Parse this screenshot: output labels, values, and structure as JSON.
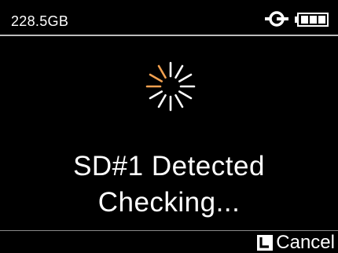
{
  "status_bar": {
    "storage_remaining": "228.5GB",
    "connector_icon": "power-connector-icon",
    "battery_icon": "battery-full-icon",
    "battery_level": 1.0
  },
  "dialog": {
    "spinner_icon": "loading-spinner-icon",
    "line1": "SD#1 Detected",
    "line2": "Checking..."
  },
  "footer": {
    "key_icon": "l-button-icon",
    "cancel_label": "Cancel"
  },
  "colors": {
    "background": "#000000",
    "text": "#ffffff",
    "spinner_highlight": "#f0a050",
    "spinner_base": "#ffffff",
    "divider": "#bcbcbc"
  }
}
